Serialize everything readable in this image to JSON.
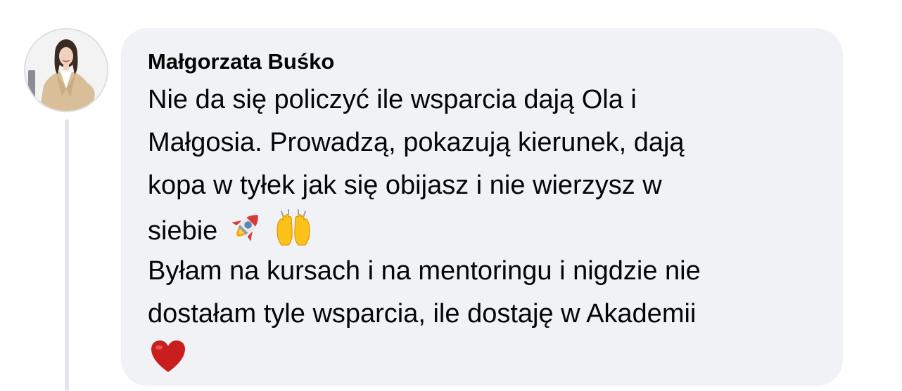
{
  "comment": {
    "author": "Małgorzata Buśko",
    "lines": [
      "Nie da się policzyć ile wsparcia dają Ola i",
      "Małgosia. Prowadzą, pokazują kierunek, dają",
      "kopa w tyłek jak się obijasz i nie wierzysz w",
      "siebie",
      "Byłam na kursach i na mentoringu i nigdzie nie",
      "dostałam tyle wsparcia, ile dostaję w Akademii"
    ],
    "emojis": [
      "🚀",
      "🙌",
      "❤️"
    ]
  },
  "colors": {
    "bubble_bg": "#f0f2f5",
    "text": "#050505",
    "thread_line": "#e4e6eb"
  },
  "icons": [
    "rocket-emoji-icon",
    "raising-hands-emoji-icon",
    "red-heart-emoji-icon"
  ]
}
